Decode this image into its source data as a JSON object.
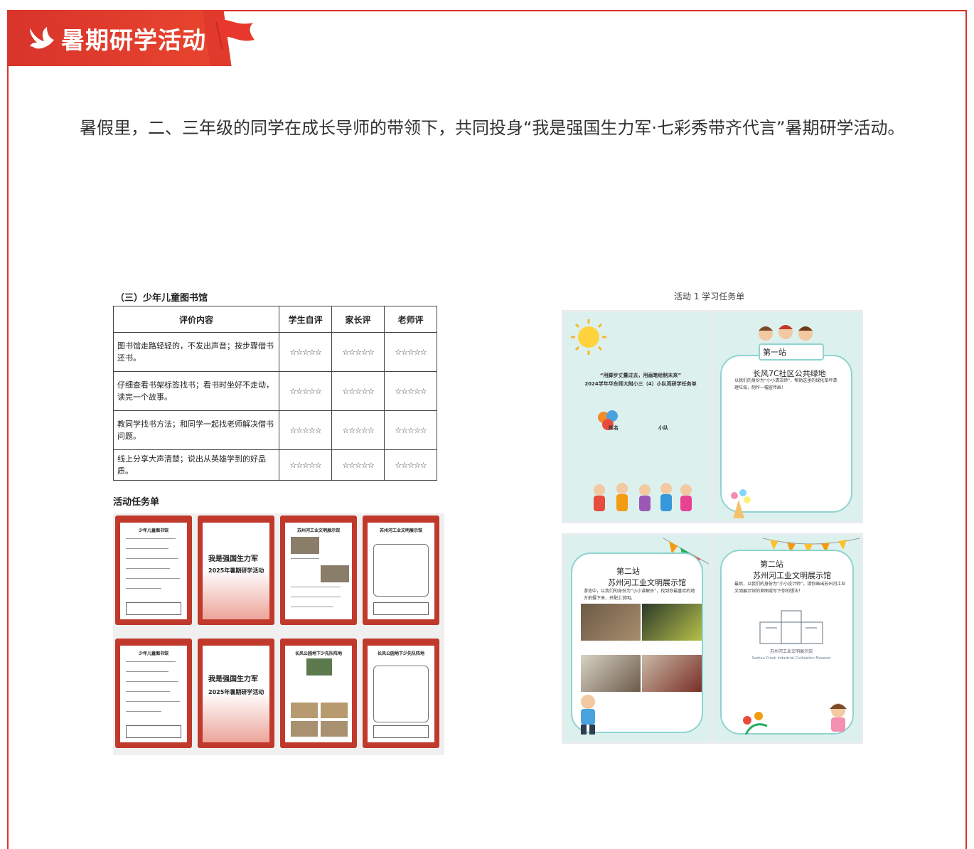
{
  "banner": {
    "title": "暑期研学活动",
    "icon": "dove-icon",
    "flag_icon": "red-flag-icon"
  },
  "intro": "暑假里，二、三年级的同学在成长导师的带领下，共同投身“我是强国生力军·七彩秀带齐代言”暑期研学活动。",
  "evaluation": {
    "caption": "（三）少年儿童图书馆",
    "headers": [
      "评价内容",
      "学生自评",
      "家长评",
      "老师评"
    ],
    "stars": "☆☆☆☆☆",
    "rows": [
      "图书馆走路轻轻的，不发出声音；按步骤借书还书。",
      "仔细查看书架标签找书；看书时坐好不走动，读完一个故事。",
      "教同学找书方法；和同学一起找老师解决借书问题。",
      "线上分享大声清楚；说出从英雄学到的好品质。"
    ]
  },
  "task_sheet": {
    "caption": "活动任务单",
    "thumb_titles": [
      "少年儿童图书馆",
      "我是强国生力军",
      "苏州河工业文明展示馆",
      "苏州河工业文明展示馆",
      "少年儿童图书馆",
      "我是强国生力军",
      "长风公园地下少先队阵地",
      "长风公园地下少先队阵地"
    ],
    "cover_sub": "2025年暑期研学活动"
  },
  "activity1": {
    "caption": "活动 1 学习任务单",
    "cover_title": "“用脚步丈量过去，用画笔绘制未来”",
    "cover_sub": "2024学年华东师大附小三（4）小队亮研学任务单",
    "name_label": "姓名",
    "team_label": "小队",
    "station1": "第一站",
    "station1_place": "长风7C社区公共绿地",
    "station1_text": "以我们的身份为“小小清洁师”，帮助这里的绿化草坪清理垃圾，制作一幅宣传画！",
    "station2": "第二站",
    "station2_place": "苏州河工业文明展示馆",
    "station2_text": "游览中，以我们的身份为“小小讲解员”，找到你最喜欢的地方拍摄下来，并配上说明。",
    "station2b_text": "最后，以我们的身份为“小小设计师”，请你画出苏州河工业文明展示馆的草图或写下你的想法！",
    "museum_cn": "苏州河工业文明展示馆",
    "museum_en": "Suzhou Creek Industrial Civilization Museum"
  },
  "colors": {
    "accent": "#d9342b",
    "card_border": "#8fd4cf",
    "page_bg": "#dcf0ee"
  }
}
